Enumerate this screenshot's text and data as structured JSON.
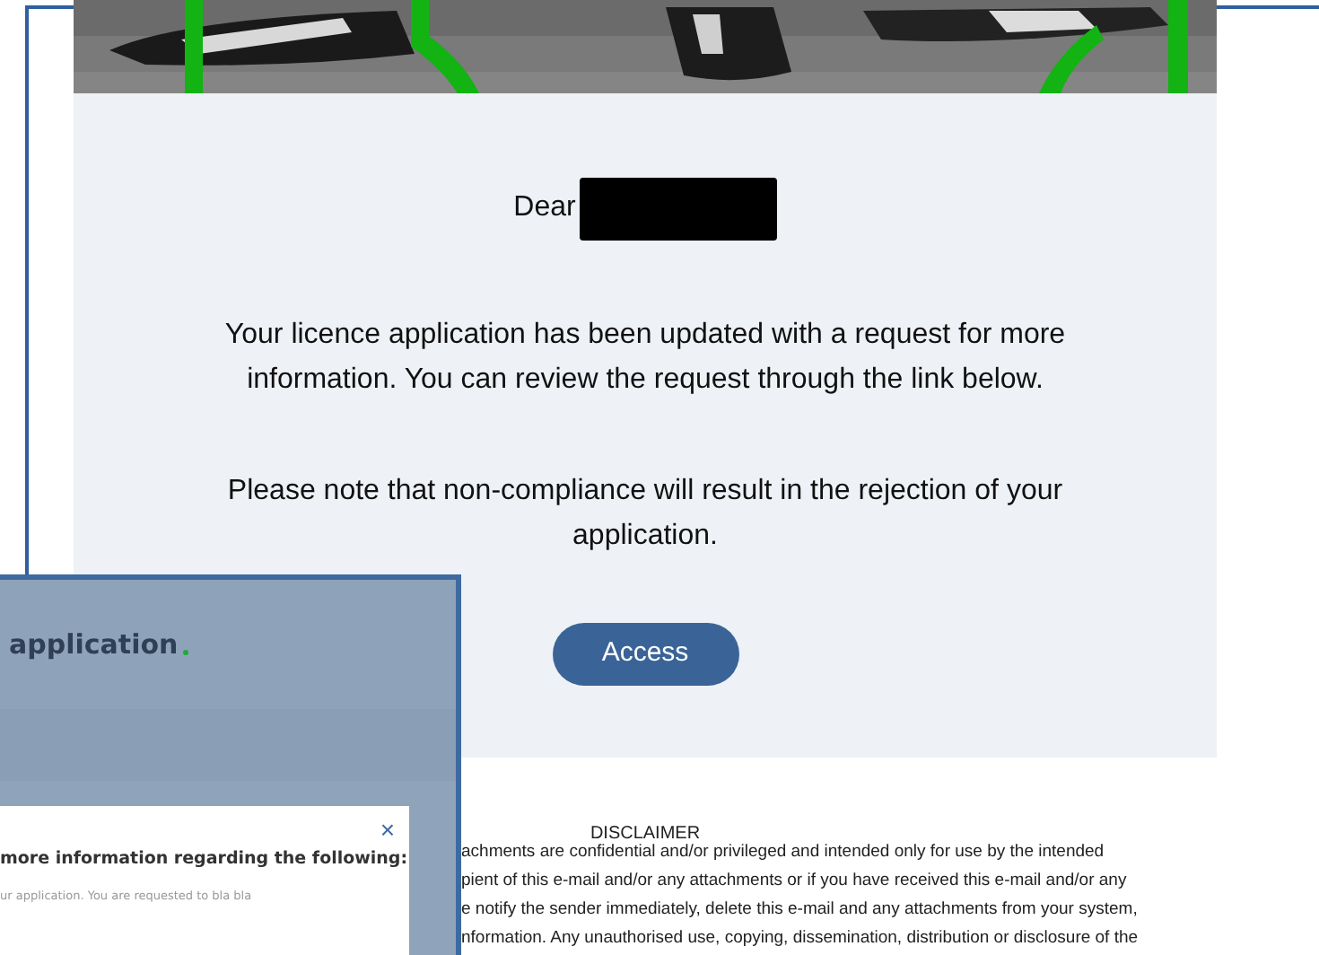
{
  "email": {
    "greeting": "Dear",
    "paragraphs": [
      "Your licence application has been updated with a request for more information. You can review the request through the link below.",
      "Please note that non-compliance will result in the rejection of your application."
    ],
    "button": "Access",
    "disclaimer": {
      "title": "DISCLAIMER",
      "lines": [
        "achments are confidential and/or privileged and intended only for use by the intended",
        "pient of this e-mail and/or any attachments or if you have received this e-mail and/or any",
        "e notify the sender immediately, delete this e-mail and any attachments from your system,",
        "nformation. Any unauthorised use, copying, dissemination, distribution or disclosure of the"
      ]
    }
  },
  "inset": {
    "heading": "application",
    "modal": {
      "close": "×",
      "heading": "more information regarding the following:",
      "body": "ur application. You are requested to bla bla"
    }
  }
}
